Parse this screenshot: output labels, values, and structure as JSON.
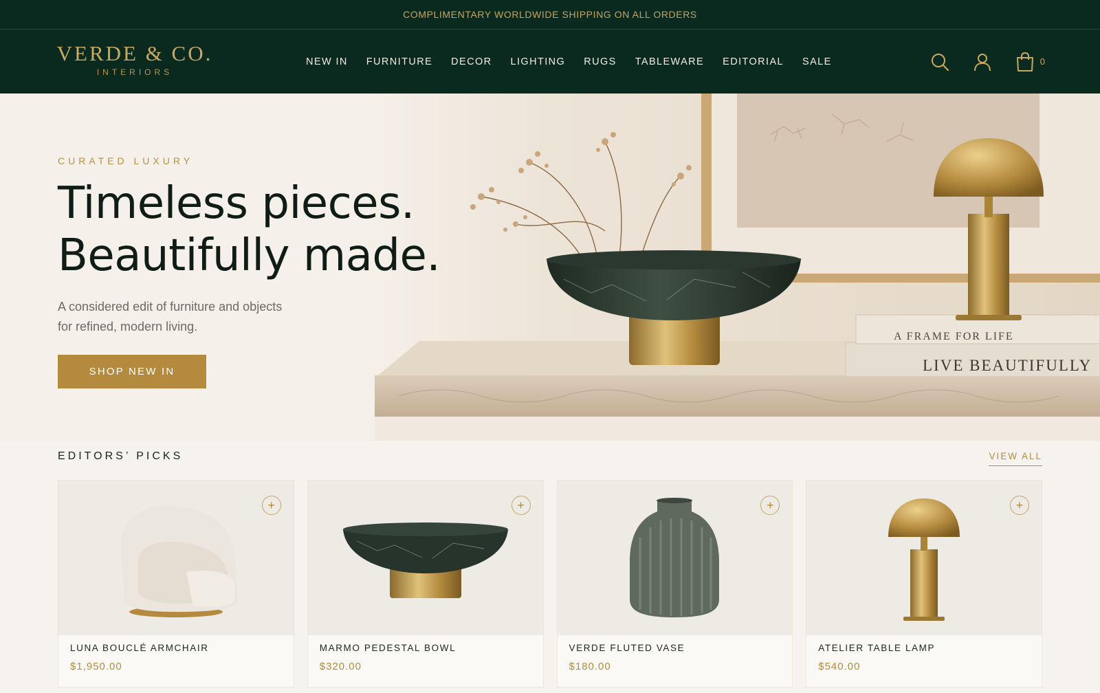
{
  "announcement": "COMPLIMENTARY WORLDWIDE SHIPPING ON ALL ORDERS",
  "brand": {
    "name": "VERDE & CO.",
    "tagline": "INTERIORS"
  },
  "nav": [
    "NEW IN",
    "FURNITURE",
    "DECOR",
    "LIGHTING",
    "RUGS",
    "TABLEWARE",
    "EDITORIAL",
    "SALE"
  ],
  "header_icons": {
    "search": "search-icon",
    "account": "user-icon",
    "cart": "shopping-bag-icon"
  },
  "cart_count": "0",
  "hero": {
    "eyebrow": "CURATED LUXURY",
    "headline_line1": "Timeless pieces.",
    "headline_line2": "Beautifully made.",
    "subtext_line1": "A considered edit of furniture and objects",
    "subtext_line2": "for refined, modern living.",
    "cta": "SHOP NEW IN",
    "book_top": "A FRAME FOR LIFE",
    "book_bottom": "LIVE BEAUTIFULLY"
  },
  "picks": {
    "title": "EDITORS’ PICKS",
    "view_all": "VIEW ALL",
    "add_symbol": "+",
    "products": [
      {
        "name": "LUNA BOUCLÉ ARMCHAIR",
        "price": "$1,950.00",
        "image": "armchair"
      },
      {
        "name": "MARMO PEDESTAL BOWL",
        "price": "$320.00",
        "image": "bowl"
      },
      {
        "name": "VERDE FLUTED VASE",
        "price": "$180.00",
        "image": "vase"
      },
      {
        "name": "ATELIER TABLE LAMP",
        "price": "$540.00",
        "image": "lamp"
      }
    ]
  },
  "colors": {
    "forest": "#0b2a1f",
    "gold": "#b48a3f",
    "cream": "#f6f3ee"
  }
}
